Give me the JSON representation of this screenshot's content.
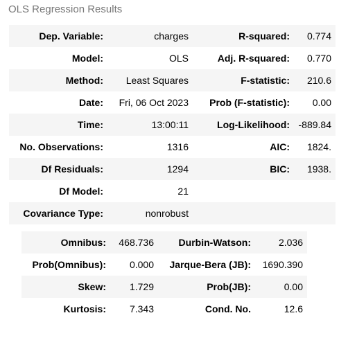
{
  "caption": "OLS Regression Results",
  "top_table": [
    [
      "Dep. Variable:",
      "charges",
      "R-squared:",
      "0.774"
    ],
    [
      "Model:",
      "OLS",
      "Adj. R-squared:",
      "0.770"
    ],
    [
      "Method:",
      "Least Squares",
      "F-statistic:",
      "210.6"
    ],
    [
      "Date:",
      "Fri, 06 Oct 2023",
      "Prob (F-statistic):",
      "0.00"
    ],
    [
      "Time:",
      "13:00:11",
      "Log-Likelihood:",
      "-889.84"
    ],
    [
      "No. Observations:",
      "1316",
      "AIC:",
      "1824."
    ],
    [
      "Df Residuals:",
      "1294",
      "BIC:",
      "1938."
    ],
    [
      "Df Model:",
      "21",
      "",
      ""
    ],
    [
      "Covariance Type:",
      "nonrobust",
      "",
      ""
    ]
  ],
  "bottom_table": [
    [
      "Omnibus:",
      "468.736",
      "Durbin-Watson:",
      "2.036"
    ],
    [
      "Prob(Omnibus):",
      "0.000",
      "Jarque-Bera (JB):",
      "1690.390"
    ],
    [
      "Skew:",
      "1.729",
      "Prob(JB):",
      "0.00"
    ],
    [
      "Kurtosis:",
      "7.343",
      "Cond. No.",
      "12.6"
    ]
  ]
}
